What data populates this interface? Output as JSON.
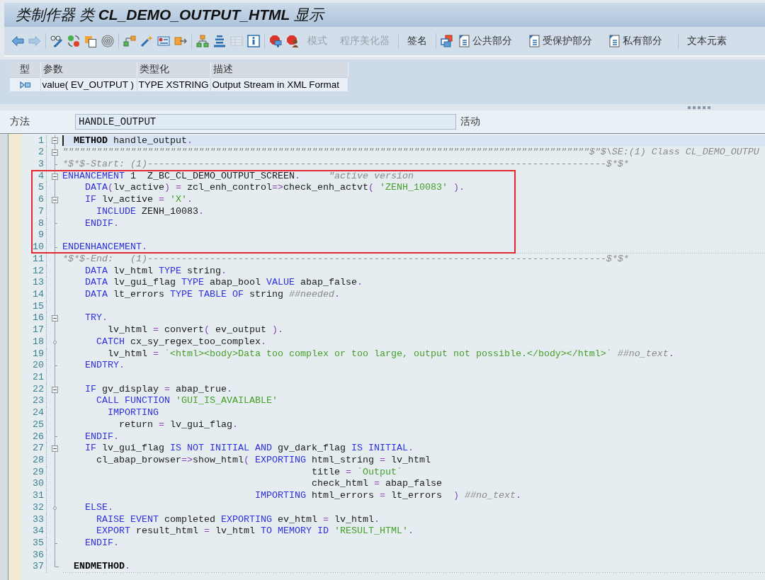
{
  "window": {
    "title": "类制作器 类 **CL_DEMO_OUTPUT_HTML** 显示"
  },
  "toolbar": {
    "groups": [
      {
        "items": [
          {
            "kind": "icon",
            "disabled": false
          },
          {
            "kind": "icon",
            "disabled": true
          }
        ]
      },
      {
        "items": [
          {
            "kind": "icon",
            "disabled": false
          },
          {
            "kind": "icon",
            "disabled": false
          },
          {
            "kind": "icon",
            "disabled": false
          },
          {
            "kind": "icon",
            "disabled": false
          }
        ]
      },
      {
        "items": [
          {
            "kind": "icon",
            "disabled": false
          },
          {
            "kind": "icon",
            "disabled": false
          },
          {
            "kind": "icon",
            "disabled": false
          },
          {
            "kind": "icon",
            "disabled": false
          }
        ]
      },
      {
        "items": [
          {
            "kind": "icon",
            "disabled": false
          },
          {
            "kind": "icon",
            "disabled": false
          },
          {
            "kind": "icon",
            "disabled": true
          },
          {
            "kind": "icon",
            "disabled": false
          }
        ]
      },
      {
        "items": [
          {
            "kind": "icon",
            "disabled": false
          },
          {
            "kind": "icon",
            "disabled": false
          },
          {
            "kind": "text",
            "label": "模式",
            "disabled": true
          },
          {
            "kind": "text",
            "label": "程序美化器",
            "disabled": true
          }
        ]
      },
      {
        "items": [
          {
            "kind": "text",
            "label": "签名",
            "disabled": false
          }
        ]
      },
      {
        "items": [
          {
            "kind": "icon",
            "disabled": false
          },
          {
            "kind": "icon_text",
            "label": "公共部分",
            "disabled": false
          },
          {
            "kind": "icon_text",
            "label": "受保护部分",
            "disabled": false
          },
          {
            "kind": "icon_text",
            "label": "私有部分",
            "disabled": false
          }
        ]
      },
      {
        "items": [
          {
            "kind": "text",
            "label": "文本元素",
            "disabled": false
          }
        ]
      }
    ]
  },
  "parameters": {
    "columns": [
      "型",
      "参数",
      "类型化",
      "描述"
    ],
    "rows": [
      {
        "parameter": "value( EV_OUTPUT )",
        "typing": "TYPE XSTRING",
        "description": "Output Stream in XML Format"
      }
    ]
  },
  "method": {
    "label": "方法",
    "value": "HANDLE_OUTPUT",
    "status": "活动"
  },
  "code": {
    "sections": [
      {
        "framed": false,
        "lines": [
          {
            "number": "1",
            "kind": "open",
            "current": true,
            "divider": false,
            "tokens": [
              {
                "kind": "block",
                "text": "  METHOD"
              },
              {
                "kind": "name",
                "text": " handle_output"
              },
              {
                "kind": "operator",
                "text": "."
              }
            ]
          },
          {
            "number": "2",
            "kind": "open",
            "current": false,
            "divider": false,
            "tokens": [
              {
                "kind": "comment",
                "text": "\"\"\"\"\"\"\"\"\"\"\"\"\"\"\"\"\"\"\"\"\"\"\"\"\"\"\"\"\"\"\"\"\"\"\"\"\"\"\"\"\"\"\"\"\"\"\"\"\"\"\"\"\"\"\"\"\"\"\"\"\"\"\"\"\"\"\"\"\"\"\"\"\"\"\"\"\"\"\"\"\"\"\"\"\"\"\"\"\"\"\"\"\"$\"$\\SE:(1) Class CL_DEMO_OUTPU"
              }
            ]
          },
          {
            "number": "3",
            "kind": "end",
            "current": false,
            "divider": false,
            "tokens": [
              {
                "kind": "comment",
                "text": "*$*$-Start: (1)---------------------------------------------------------------------------------$*$*"
              }
            ]
          }
        ]
      },
      {
        "framed": true,
        "lines": [
          {
            "number": "4",
            "kind": "open",
            "current": false,
            "divider": false,
            "tokens": [
              {
                "kind": "keyword",
                "text": "ENHANCEMENT"
              },
              {
                "kind": "name",
                "text": " 1  Z_BC_CL_DEMO_OUTPUT_SCREEN"
              },
              {
                "kind": "operator",
                "text": "."
              },
              {
                "kind": "comment",
                "text": "     \"active version"
              }
            ]
          },
          {
            "number": "5",
            "kind": "plain",
            "current": false,
            "divider": false,
            "tokens": [
              {
                "kind": "keyword",
                "text": "    DATA"
              },
              {
                "kind": "operator",
                "text": "("
              },
              {
                "kind": "name",
                "text": "lv_active"
              },
              {
                "kind": "operator",
                "text": ") = "
              },
              {
                "kind": "name",
                "text": "zcl_enh_control"
              },
              {
                "kind": "operator",
                "text": "=>"
              },
              {
                "kind": "name",
                "text": "check_enh_actvt"
              },
              {
                "kind": "operator",
                "text": "( "
              },
              {
                "kind": "string",
                "text": "'ZENH_10083'"
              },
              {
                "kind": "operator",
                "text": " )."
              }
            ]
          },
          {
            "number": "6",
            "kind": "open",
            "current": false,
            "divider": false,
            "tokens": [
              {
                "kind": "keyword",
                "text": "    IF"
              },
              {
                "kind": "name",
                "text": " lv_active"
              },
              {
                "kind": "operator",
                "text": " = "
              },
              {
                "kind": "string",
                "text": "'X'"
              },
              {
                "kind": "operator",
                "text": "."
              }
            ]
          },
          {
            "number": "7",
            "kind": "plain",
            "current": false,
            "divider": false,
            "tokens": [
              {
                "kind": "keyword",
                "text": "      INCLUDE"
              },
              {
                "kind": "name",
                "text": " ZENH_10083"
              },
              {
                "kind": "operator",
                "text": "."
              }
            ]
          },
          {
            "number": "8",
            "kind": "end",
            "current": false,
            "divider": false,
            "tokens": [
              {
                "kind": "keyword",
                "text": "    ENDIF"
              },
              {
                "kind": "operator",
                "text": "."
              }
            ]
          },
          {
            "number": "9",
            "kind": "plain",
            "current": false,
            "divider": false
          },
          {
            "number": "10",
            "kind": "end",
            "current": false,
            "divider": true,
            "tokens": [
              {
                "kind": "keyword",
                "text": "ENDENHANCEMENT"
              },
              {
                "kind": "operator",
                "text": "."
              }
            ]
          }
        ]
      },
      {
        "framed": false,
        "lines": [
          {
            "number": "11",
            "kind": "plain",
            "current": false,
            "divider": false,
            "tokens": [
              {
                "kind": "comment",
                "text": "*$*$-End:   (1)---------------------------------------------------------------------------------$*$*"
              }
            ]
          },
          {
            "number": "12",
            "kind": "plain",
            "current": false,
            "divider": false,
            "tokens": [
              {
                "kind": "keyword",
                "text": "    DATA"
              },
              {
                "kind": "name",
                "text": " lv_html"
              },
              {
                "kind": "keyword",
                "text": " TYPE"
              },
              {
                "kind": "name",
                "text": " string"
              },
              {
                "kind": "operator",
                "text": "."
              }
            ]
          },
          {
            "number": "13",
            "kind": "plain",
            "current": false,
            "divider": false,
            "tokens": [
              {
                "kind": "keyword",
                "text": "    DATA"
              },
              {
                "kind": "name",
                "text": " lv_gui_flag"
              },
              {
                "kind": "keyword",
                "text": " TYPE"
              },
              {
                "kind": "name",
                "text": " abap_bool"
              },
              {
                "kind": "keyword",
                "text": " VALUE"
              },
              {
                "kind": "name",
                "text": " abap_false"
              },
              {
                "kind": "operator",
                "text": "."
              }
            ]
          },
          {
            "number": "14",
            "kind": "plain",
            "current": false,
            "divider": false,
            "tokens": [
              {
                "kind": "keyword",
                "text": "    DATA"
              },
              {
                "kind": "name",
                "text": " lt_errors"
              },
              {
                "kind": "keyword",
                "text": " TYPE TABLE OF"
              },
              {
                "kind": "name",
                "text": " string"
              },
              {
                "kind": "comment",
                "text": " ##needed"
              },
              {
                "kind": "operator",
                "text": "."
              }
            ]
          },
          {
            "number": "15",
            "kind": "plain",
            "current": false,
            "divider": false
          },
          {
            "number": "16",
            "kind": "open",
            "current": false,
            "divider": false,
            "tokens": [
              {
                "kind": "keyword",
                "text": "    TRY"
              },
              {
                "kind": "operator",
                "text": "."
              }
            ]
          },
          {
            "number": "17",
            "kind": "plain",
            "current": false,
            "divider": false,
            "tokens": [
              {
                "kind": "name",
                "text": "        lv_html"
              },
              {
                "kind": "operator",
                "text": " = "
              },
              {
                "kind": "name",
                "text": "convert"
              },
              {
                "kind": "operator",
                "text": "( "
              },
              {
                "kind": "name",
                "text": "ev_output"
              },
              {
                "kind": "operator",
                "text": " )."
              }
            ]
          },
          {
            "number": "18",
            "kind": "branch",
            "current": false,
            "divider": false,
            "tokens": [
              {
                "kind": "keyword",
                "text": "      CATCH"
              },
              {
                "kind": "name",
                "text": " cx_sy_regex_too_complex"
              },
              {
                "kind": "operator",
                "text": "."
              }
            ]
          },
          {
            "number": "19",
            "kind": "plain",
            "current": false,
            "divider": false,
            "tokens": [
              {
                "kind": "name",
                "text": "        lv_html"
              },
              {
                "kind": "operator",
                "text": " = "
              },
              {
                "kind": "string",
                "text": "`<html><body>Data too complex or too large, output not possible.</body></html>`"
              },
              {
                "kind": "comment",
                "text": " ##no_text"
              },
              {
                "kind": "operator",
                "text": "."
              }
            ]
          },
          {
            "number": "20",
            "kind": "end",
            "current": false,
            "divider": false,
            "tokens": [
              {
                "kind": "keyword",
                "text": "    ENDTRY"
              },
              {
                "kind": "operator",
                "text": "."
              }
            ]
          },
          {
            "number": "21",
            "kind": "plain",
            "current": false,
            "divider": false
          },
          {
            "number": "22",
            "kind": "open",
            "current": false,
            "divider": false,
            "tokens": [
              {
                "kind": "keyword",
                "text": "    IF"
              },
              {
                "kind": "name",
                "text": " gv_display"
              },
              {
                "kind": "operator",
                "text": " = "
              },
              {
                "kind": "name",
                "text": "abap_true"
              },
              {
                "kind": "operator",
                "text": "."
              }
            ]
          },
          {
            "number": "23",
            "kind": "plain",
            "current": false,
            "divider": false,
            "tokens": [
              {
                "kind": "keyword",
                "text": "      CALL FUNCTION"
              },
              {
                "kind": "string",
                "text": " 'GUI_IS_AVAILABLE'"
              }
            ]
          },
          {
            "number": "24",
            "kind": "plain",
            "current": false,
            "divider": false,
            "tokens": [
              {
                "kind": "keyword",
                "text": "        IMPORTING"
              }
            ]
          },
          {
            "number": "25",
            "kind": "plain",
            "current": false,
            "divider": false,
            "tokens": [
              {
                "kind": "name",
                "text": "          return"
              },
              {
                "kind": "operator",
                "text": " = "
              },
              {
                "kind": "name",
                "text": "lv_gui_flag"
              },
              {
                "kind": "operator",
                "text": "."
              }
            ]
          },
          {
            "number": "26",
            "kind": "end",
            "current": false,
            "divider": false,
            "tokens": [
              {
                "kind": "keyword",
                "text": "    ENDIF"
              },
              {
                "kind": "operator",
                "text": "."
              }
            ]
          },
          {
            "number": "27",
            "kind": "open",
            "current": false,
            "divider": false,
            "tokens": [
              {
                "kind": "keyword",
                "text": "    IF"
              },
              {
                "kind": "name",
                "text": " lv_gui_flag"
              },
              {
                "kind": "keyword",
                "text": " IS NOT INITIAL AND"
              },
              {
                "kind": "name",
                "text": " gv_dark_flag"
              },
              {
                "kind": "keyword",
                "text": " IS INITIAL"
              },
              {
                "kind": "operator",
                "text": "."
              }
            ]
          },
          {
            "number": "28",
            "kind": "plain",
            "current": false,
            "divider": false,
            "tokens": [
              {
                "kind": "name",
                "text": "      cl_abap_browser"
              },
              {
                "kind": "operator",
                "text": "=>"
              },
              {
                "kind": "name",
                "text": "show_html"
              },
              {
                "kind": "operator",
                "text": "( "
              },
              {
                "kind": "keyword",
                "text": "EXPORTING"
              },
              {
                "kind": "name",
                "text": " html_string"
              },
              {
                "kind": "operator",
                "text": " = "
              },
              {
                "kind": "name",
                "text": "lv_html"
              }
            ]
          },
          {
            "number": "29",
            "kind": "plain",
            "current": false,
            "divider": false,
            "tokens": [
              {
                "kind": "name",
                "text": "                                            title"
              },
              {
                "kind": "operator",
                "text": " = "
              },
              {
                "kind": "string",
                "text": "`Output`"
              }
            ]
          },
          {
            "number": "30",
            "kind": "plain",
            "current": false,
            "divider": false,
            "tokens": [
              {
                "kind": "name",
                "text": "                                            check_html"
              },
              {
                "kind": "operator",
                "text": " = "
              },
              {
                "kind": "name",
                "text": "abap_false"
              }
            ]
          },
          {
            "number": "31",
            "kind": "plain",
            "current": false,
            "divider": false,
            "tokens": [
              {
                "kind": "keyword",
                "text": "                                  IMPORTING"
              },
              {
                "kind": "name",
                "text": " html_errors"
              },
              {
                "kind": "operator",
                "text": " = "
              },
              {
                "kind": "name",
                "text": "lt_errors"
              },
              {
                "kind": "operator",
                "text": "  )"
              },
              {
                "kind": "comment",
                "text": " ##no_text"
              },
              {
                "kind": "operator",
                "text": "."
              }
            ]
          },
          {
            "number": "32",
            "kind": "branch",
            "current": false,
            "divider": false,
            "tokens": [
              {
                "kind": "keyword",
                "text": "    ELSE"
              },
              {
                "kind": "operator",
                "text": "."
              }
            ]
          },
          {
            "number": "33",
            "kind": "plain",
            "current": false,
            "divider": false,
            "tokens": [
              {
                "kind": "keyword",
                "text": "      RAISE EVENT"
              },
              {
                "kind": "name",
                "text": " completed"
              },
              {
                "kind": "keyword",
                "text": " EXPORTING"
              },
              {
                "kind": "name",
                "text": " ev_html"
              },
              {
                "kind": "operator",
                "text": " = "
              },
              {
                "kind": "name",
                "text": "lv_html"
              },
              {
                "kind": "operator",
                "text": "."
              }
            ]
          },
          {
            "number": "34",
            "kind": "plain",
            "current": false,
            "divider": false,
            "tokens": [
              {
                "kind": "keyword",
                "text": "      EXPORT"
              },
              {
                "kind": "name",
                "text": " result_html"
              },
              {
                "kind": "operator",
                "text": " = "
              },
              {
                "kind": "name",
                "text": "lv_html"
              },
              {
                "kind": "keyword",
                "text": " TO MEMORY ID"
              },
              {
                "kind": "string",
                "text": " 'RESULT_HTML'"
              },
              {
                "kind": "operator",
                "text": "."
              }
            ]
          },
          {
            "number": "35",
            "kind": "end",
            "current": false,
            "divider": false,
            "tokens": [
              {
                "kind": "keyword",
                "text": "    ENDIF"
              },
              {
                "kind": "operator",
                "text": "."
              }
            ]
          },
          {
            "number": "36",
            "kind": "plain",
            "current": false,
            "divider": false
          },
          {
            "number": "37",
            "kind": "corner",
            "current": false,
            "divider": true,
            "tokens": [
              {
                "kind": "block",
                "text": "  ENDMETHOD"
              },
              {
                "kind": "operator",
                "text": "."
              }
            ]
          }
        ]
      }
    ]
  }
}
